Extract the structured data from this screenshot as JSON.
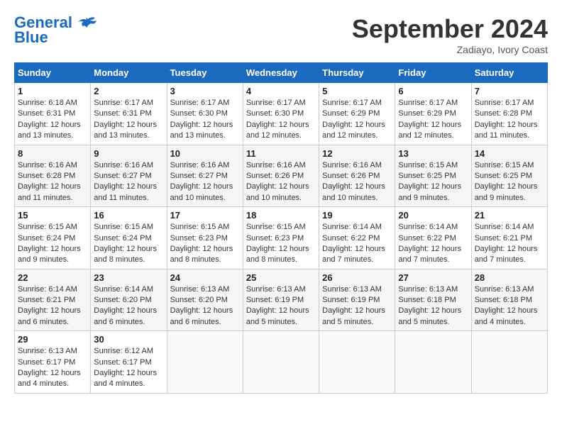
{
  "header": {
    "logo_line1": "General",
    "logo_line2": "Blue",
    "month_title": "September 2024",
    "location": "Zadiayo, Ivory Coast"
  },
  "weekdays": [
    "Sunday",
    "Monday",
    "Tuesday",
    "Wednesday",
    "Thursday",
    "Friday",
    "Saturday"
  ],
  "weeks": [
    [
      {
        "day": "1",
        "sunrise": "6:18 AM",
        "sunset": "6:31 PM",
        "daylight": "12 hours and 13 minutes."
      },
      {
        "day": "2",
        "sunrise": "6:17 AM",
        "sunset": "6:31 PM",
        "daylight": "12 hours and 13 minutes."
      },
      {
        "day": "3",
        "sunrise": "6:17 AM",
        "sunset": "6:30 PM",
        "daylight": "12 hours and 13 minutes."
      },
      {
        "day": "4",
        "sunrise": "6:17 AM",
        "sunset": "6:30 PM",
        "daylight": "12 hours and 12 minutes."
      },
      {
        "day": "5",
        "sunrise": "6:17 AM",
        "sunset": "6:29 PM",
        "daylight": "12 hours and 12 minutes."
      },
      {
        "day": "6",
        "sunrise": "6:17 AM",
        "sunset": "6:29 PM",
        "daylight": "12 hours and 12 minutes."
      },
      {
        "day": "7",
        "sunrise": "6:17 AM",
        "sunset": "6:28 PM",
        "daylight": "12 hours and 11 minutes."
      }
    ],
    [
      {
        "day": "8",
        "sunrise": "6:16 AM",
        "sunset": "6:28 PM",
        "daylight": "12 hours and 11 minutes."
      },
      {
        "day": "9",
        "sunrise": "6:16 AM",
        "sunset": "6:27 PM",
        "daylight": "12 hours and 11 minutes."
      },
      {
        "day": "10",
        "sunrise": "6:16 AM",
        "sunset": "6:27 PM",
        "daylight": "12 hours and 10 minutes."
      },
      {
        "day": "11",
        "sunrise": "6:16 AM",
        "sunset": "6:26 PM",
        "daylight": "12 hours and 10 minutes."
      },
      {
        "day": "12",
        "sunrise": "6:16 AM",
        "sunset": "6:26 PM",
        "daylight": "12 hours and 10 minutes."
      },
      {
        "day": "13",
        "sunrise": "6:15 AM",
        "sunset": "6:25 PM",
        "daylight": "12 hours and 9 minutes."
      },
      {
        "day": "14",
        "sunrise": "6:15 AM",
        "sunset": "6:25 PM",
        "daylight": "12 hours and 9 minutes."
      }
    ],
    [
      {
        "day": "15",
        "sunrise": "6:15 AM",
        "sunset": "6:24 PM",
        "daylight": "12 hours and 9 minutes."
      },
      {
        "day": "16",
        "sunrise": "6:15 AM",
        "sunset": "6:24 PM",
        "daylight": "12 hours and 8 minutes."
      },
      {
        "day": "17",
        "sunrise": "6:15 AM",
        "sunset": "6:23 PM",
        "daylight": "12 hours and 8 minutes."
      },
      {
        "day": "18",
        "sunrise": "6:15 AM",
        "sunset": "6:23 PM",
        "daylight": "12 hours and 8 minutes."
      },
      {
        "day": "19",
        "sunrise": "6:14 AM",
        "sunset": "6:22 PM",
        "daylight": "12 hours and 7 minutes."
      },
      {
        "day": "20",
        "sunrise": "6:14 AM",
        "sunset": "6:22 PM",
        "daylight": "12 hours and 7 minutes."
      },
      {
        "day": "21",
        "sunrise": "6:14 AM",
        "sunset": "6:21 PM",
        "daylight": "12 hours and 7 minutes."
      }
    ],
    [
      {
        "day": "22",
        "sunrise": "6:14 AM",
        "sunset": "6:21 PM",
        "daylight": "12 hours and 6 minutes."
      },
      {
        "day": "23",
        "sunrise": "6:14 AM",
        "sunset": "6:20 PM",
        "daylight": "12 hours and 6 minutes."
      },
      {
        "day": "24",
        "sunrise": "6:13 AM",
        "sunset": "6:20 PM",
        "daylight": "12 hours and 6 minutes."
      },
      {
        "day": "25",
        "sunrise": "6:13 AM",
        "sunset": "6:19 PM",
        "daylight": "12 hours and 5 minutes."
      },
      {
        "day": "26",
        "sunrise": "6:13 AM",
        "sunset": "6:19 PM",
        "daylight": "12 hours and 5 minutes."
      },
      {
        "day": "27",
        "sunrise": "6:13 AM",
        "sunset": "6:18 PM",
        "daylight": "12 hours and 5 minutes."
      },
      {
        "day": "28",
        "sunrise": "6:13 AM",
        "sunset": "6:18 PM",
        "daylight": "12 hours and 4 minutes."
      }
    ],
    [
      {
        "day": "29",
        "sunrise": "6:13 AM",
        "sunset": "6:17 PM",
        "daylight": "12 hours and 4 minutes."
      },
      {
        "day": "30",
        "sunrise": "6:12 AM",
        "sunset": "6:17 PM",
        "daylight": "12 hours and 4 minutes."
      },
      null,
      null,
      null,
      null,
      null
    ]
  ],
  "labels": {
    "sunrise": "Sunrise: ",
    "sunset": "Sunset: ",
    "daylight": "Daylight: "
  }
}
